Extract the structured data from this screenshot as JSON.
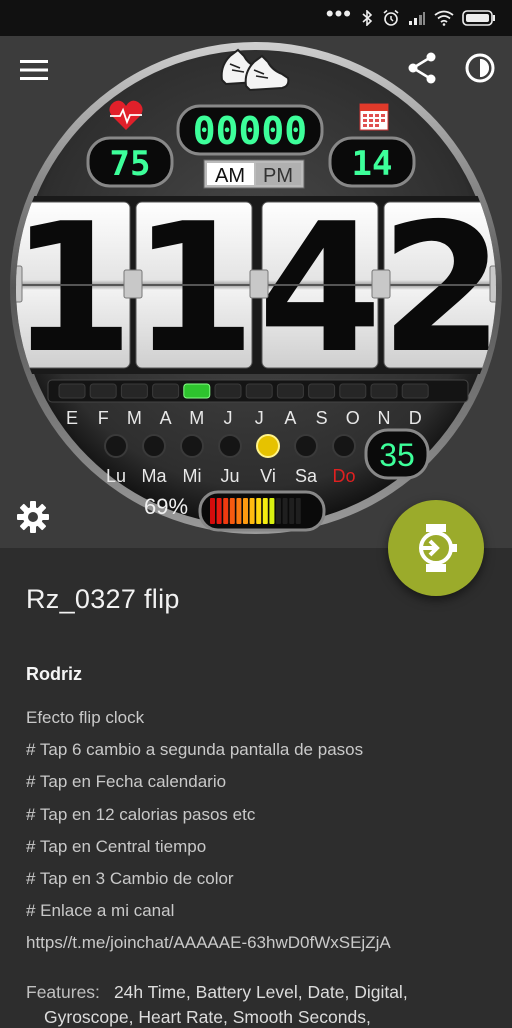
{
  "status_bar": {
    "icons": [
      "more-dots",
      "bluetooth-icon",
      "alarm-icon",
      "signal-icon",
      "wifi-icon",
      "battery-icon"
    ]
  },
  "toolbar": {
    "menu_icon": "hamburger-menu-icon",
    "share_icon": "share-icon",
    "theme_icon": "night-mode-icon",
    "settings_icon": "gear-icon"
  },
  "watch_face": {
    "step_counter": "00000",
    "heart_rate": "75",
    "date_day": "14",
    "am": "AM",
    "pm": "PM",
    "time_digits": [
      "1",
      "1",
      "4",
      "2"
    ],
    "months": [
      "E",
      "F",
      "M",
      "A",
      "M",
      "J",
      "J",
      "A",
      "S",
      "O",
      "N",
      "D"
    ],
    "active_month_index": 4,
    "weekdays": [
      "Lu",
      "Ma",
      "Mi",
      "Ju",
      "Vi",
      "Sa",
      "Do"
    ],
    "active_weekday_index": 4,
    "week_number": "35",
    "battery_percent": "69%",
    "battery_level": 0.69,
    "colors": {
      "lcd_digits": "#3dff9a",
      "month_active": "#2ec42e",
      "weekday_active": "#e6c200",
      "sunday_label": "#e02020",
      "fab": "#9bab2b"
    }
  },
  "watchface_info": {
    "name": "Rz_0327 flip",
    "author": "Rodriz",
    "description_lines": [
      "Efecto flip clock",
      "# Tap 6 cambio a segunda pantalla de pasos",
      "# Tap en Fecha calendario",
      "# Tap en 12 calorias pasos etc",
      "# Tap en Central tiempo",
      "# Tap en 3 Cambio de color",
      "# Enlace a mi canal",
      "https//t.me/joinchat/AAAAAE-63hwD0fWxSEjZjA"
    ],
    "features_label": "Features:",
    "features_line1": "24h Time,  Battery Level,  Date,  Digital,",
    "features_line2": "Gyroscope,  Heart Rate,  Smooth Seconds,"
  },
  "fab": {
    "icon": "apply-to-watch-icon"
  }
}
